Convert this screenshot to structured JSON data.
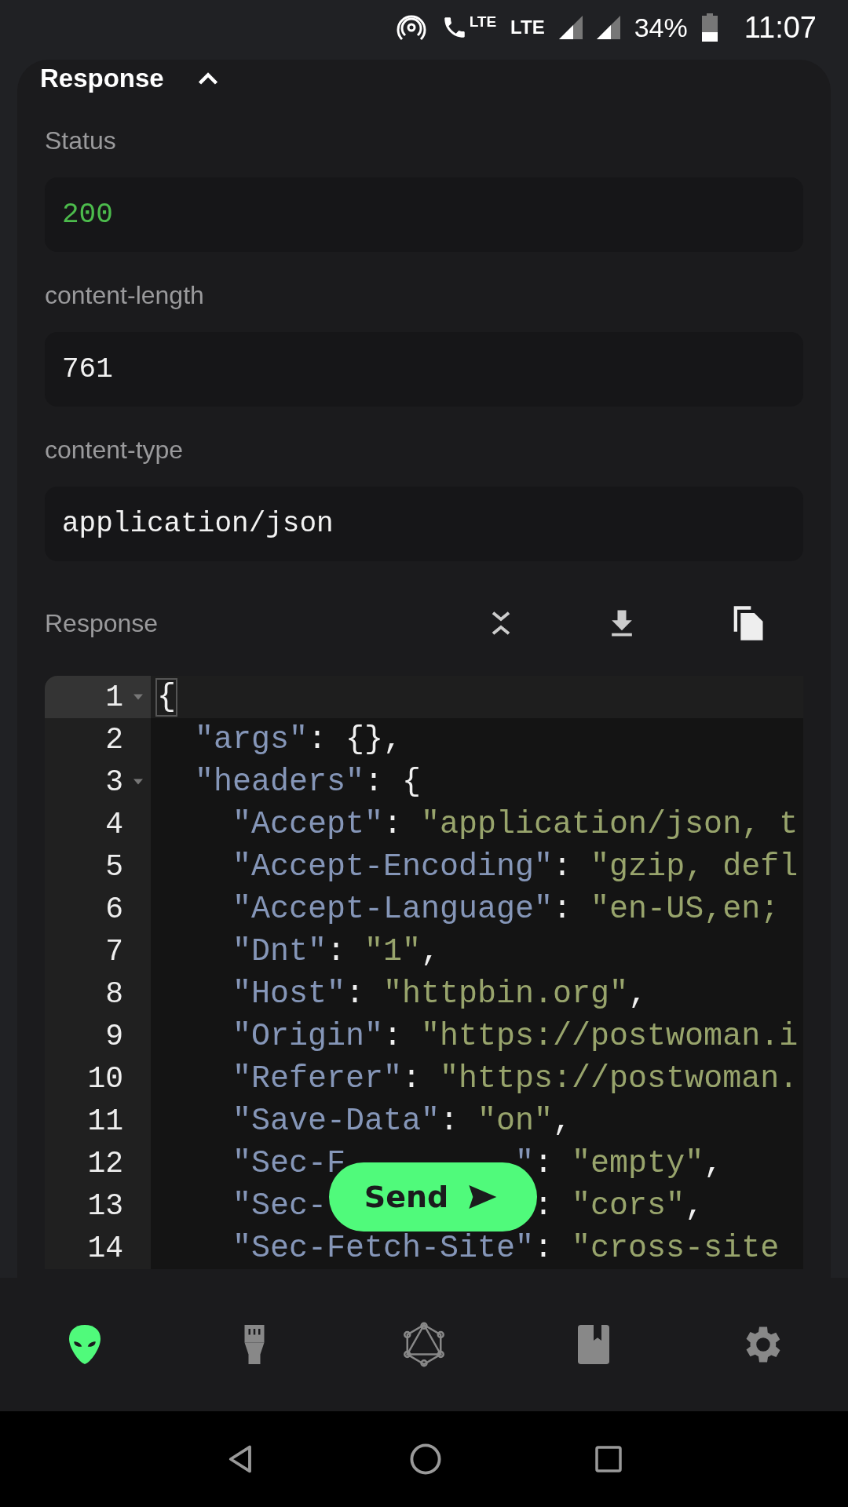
{
  "status_bar": {
    "network_labels": [
      "LTE",
      "LTE"
    ],
    "battery": "34%",
    "time": "11:07"
  },
  "section": {
    "title": "Response",
    "expanded": true
  },
  "fields": [
    {
      "label": "Status",
      "value": "200",
      "kind": "status"
    },
    {
      "label": "content-length",
      "value": "761",
      "kind": "plain"
    },
    {
      "label": "content-type",
      "value": "application/json",
      "kind": "plain"
    }
  ],
  "response": {
    "label": "Response",
    "lines": [
      {
        "n": "1",
        "active": true,
        "foldable": true,
        "parts": [
          [
            {
              "kind": "matched",
              "text": "{"
            }
          ]
        ]
      },
      {
        "n": "2",
        "active": false,
        "foldable": false,
        "parts": [
          [
            {
              "kind": "key",
              "text": "  \"args\""
            },
            {
              "kind": "punct",
              "text": ": {},"
            }
          ]
        ]
      },
      {
        "n": "3",
        "active": false,
        "foldable": true,
        "parts": [
          [
            {
              "kind": "key",
              "text": "  \"headers\""
            },
            {
              "kind": "punct",
              "text": ": {"
            }
          ]
        ]
      },
      {
        "n": "4",
        "active": false,
        "foldable": false,
        "parts": [
          [
            {
              "kind": "key",
              "text": "    \"Accept\""
            },
            {
              "kind": "punct",
              "text": ": "
            },
            {
              "kind": "str",
              "text": "\"application/json, t"
            }
          ]
        ]
      },
      {
        "n": "5",
        "active": false,
        "foldable": false,
        "parts": [
          [
            {
              "kind": "key",
              "text": "    \"Accept-Encoding\""
            },
            {
              "kind": "punct",
              "text": ": "
            },
            {
              "kind": "str",
              "text": "\"gzip, defl"
            }
          ]
        ]
      },
      {
        "n": "6",
        "active": false,
        "foldable": false,
        "parts": [
          [
            {
              "kind": "key",
              "text": "    \"Accept-Language\""
            },
            {
              "kind": "punct",
              "text": ": "
            },
            {
              "kind": "str",
              "text": "\"en-US,en;"
            }
          ]
        ]
      },
      {
        "n": "7",
        "active": false,
        "foldable": false,
        "parts": [
          [
            {
              "kind": "key",
              "text": "    \"Dnt\""
            },
            {
              "kind": "punct",
              "text": ": "
            },
            {
              "kind": "str",
              "text": "\"1\""
            },
            {
              "kind": "punct",
              "text": ","
            }
          ]
        ]
      },
      {
        "n": "8",
        "active": false,
        "foldable": false,
        "parts": [
          [
            {
              "kind": "key",
              "text": "    \"Host\""
            },
            {
              "kind": "punct",
              "text": ": "
            },
            {
              "kind": "str",
              "text": "\"httpbin.org\""
            },
            {
              "kind": "punct",
              "text": ","
            }
          ]
        ]
      },
      {
        "n": "9",
        "active": false,
        "foldable": false,
        "parts": [
          [
            {
              "kind": "key",
              "text": "    \"Origin\""
            },
            {
              "kind": "punct",
              "text": ": "
            },
            {
              "kind": "str",
              "text": "\"https://postwoman.i"
            }
          ]
        ]
      },
      {
        "n": "10",
        "active": false,
        "foldable": false,
        "parts": [
          [
            {
              "kind": "key",
              "text": "    \"Referer\""
            },
            {
              "kind": "punct",
              "text": ": "
            },
            {
              "kind": "str",
              "text": "\"https://postwoman."
            }
          ]
        ]
      },
      {
        "n": "11",
        "active": false,
        "foldable": false,
        "parts": [
          [
            {
              "kind": "key",
              "text": "    \"Save-Data\""
            },
            {
              "kind": "punct",
              "text": ": "
            },
            {
              "kind": "str",
              "text": "\"on\""
            },
            {
              "kind": "punct",
              "text": ","
            }
          ]
        ]
      },
      {
        "n": "12",
        "active": false,
        "foldable": false,
        "parts": [
          [
            {
              "kind": "key",
              "text": "    \"Sec-F"
            }
          ],
          [
            {
              "kind": "key",
              "text": "\""
            },
            {
              "kind": "punct",
              "text": ": "
            },
            {
              "kind": "str",
              "text": "\"empty\""
            },
            {
              "kind": "punct",
              "text": ","
            }
          ]
        ]
      },
      {
        "n": "13",
        "active": false,
        "foldable": false,
        "parts": [
          [
            {
              "kind": "key",
              "text": "    \"Sec-"
            }
          ],
          [
            {
              "kind": "punct",
              "text": ": "
            },
            {
              "kind": "str",
              "text": "\"cors\""
            },
            {
              "kind": "punct",
              "text": ","
            }
          ]
        ]
      },
      {
        "n": "14",
        "active": false,
        "foldable": false,
        "parts": [
          [
            {
              "kind": "key",
              "text": "    \"Sec-Fetch-Site\""
            },
            {
              "kind": "punct",
              "text": ": "
            },
            {
              "kind": "str",
              "text": "\"cross-site"
            }
          ]
        ]
      }
    ]
  },
  "send_button": {
    "label": "Send"
  },
  "bottom_nav": [
    {
      "kind": "alien",
      "selected": true
    },
    {
      "kind": "plug",
      "selected": false
    },
    {
      "kind": "graph",
      "selected": false
    },
    {
      "kind": "book",
      "selected": false
    },
    {
      "kind": "gear",
      "selected": false
    }
  ]
}
